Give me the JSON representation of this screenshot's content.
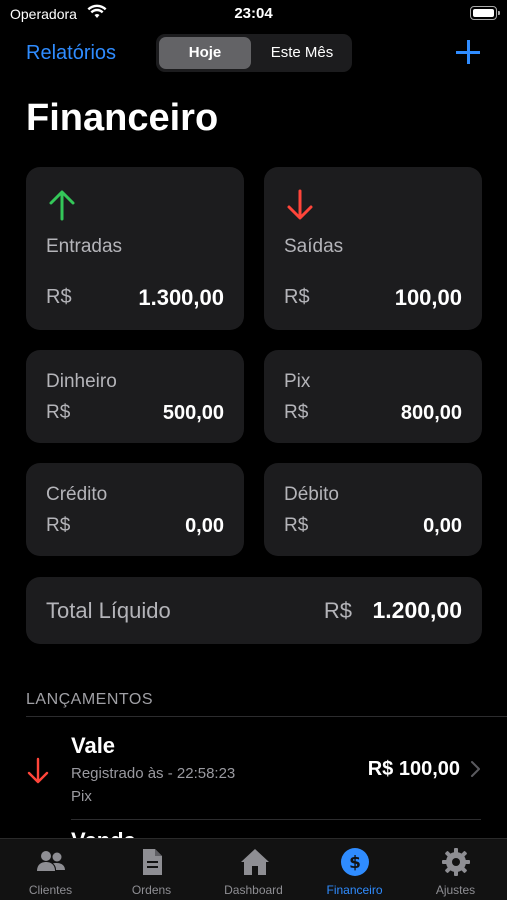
{
  "status_bar": {
    "carrier": "Operadora",
    "time": "23:04"
  },
  "nav": {
    "back_label": "Relatórios",
    "segments": [
      "Hoje",
      "Este Mês"
    ],
    "selected_segment": "Hoje",
    "add_icon": "plus-icon"
  },
  "title": "Financeiro",
  "summary": {
    "entradas": {
      "label": "Entradas",
      "currency": "R$",
      "value": "1.300,00",
      "icon": "arrow-up-icon",
      "color": "#34c759"
    },
    "saidas": {
      "label": "Saídas",
      "currency": "R$",
      "value": "100,00",
      "icon": "arrow-down-icon",
      "color": "#ff453a"
    }
  },
  "methods": {
    "dinheiro": {
      "label": "Dinheiro",
      "currency": "R$",
      "value": "500,00"
    },
    "pix": {
      "label": "Pix",
      "currency": "R$",
      "value": "800,00"
    },
    "credito": {
      "label": "Crédito",
      "currency": "R$",
      "value": "0,00"
    },
    "debito": {
      "label": "Débito",
      "currency": "R$",
      "value": "0,00"
    }
  },
  "total": {
    "label": "Total Líquido",
    "currency": "R$",
    "value": "1.200,00"
  },
  "lancamentos": {
    "header": "LANÇAMENTOS",
    "items": [
      {
        "title": "Vale",
        "subtitle": "Registrado às - 22:58:23",
        "method": "Pix",
        "amount": "R$ 100,00",
        "icon": "arrow-down-icon"
      }
    ],
    "peek_title": "Venda"
  },
  "tabbar": {
    "items": [
      {
        "label": "Clientes",
        "icon": "people-icon"
      },
      {
        "label": "Ordens",
        "icon": "document-icon"
      },
      {
        "label": "Dashboard",
        "icon": "house-icon"
      },
      {
        "label": "Financeiro",
        "icon": "dollar-circle-icon"
      },
      {
        "label": "Ajustes",
        "icon": "gear-icon"
      }
    ],
    "active": "Financeiro"
  },
  "colors": {
    "accent": "#2f8cff",
    "income": "#34c759",
    "expense": "#ff453a",
    "card": "#1c1c1e"
  }
}
